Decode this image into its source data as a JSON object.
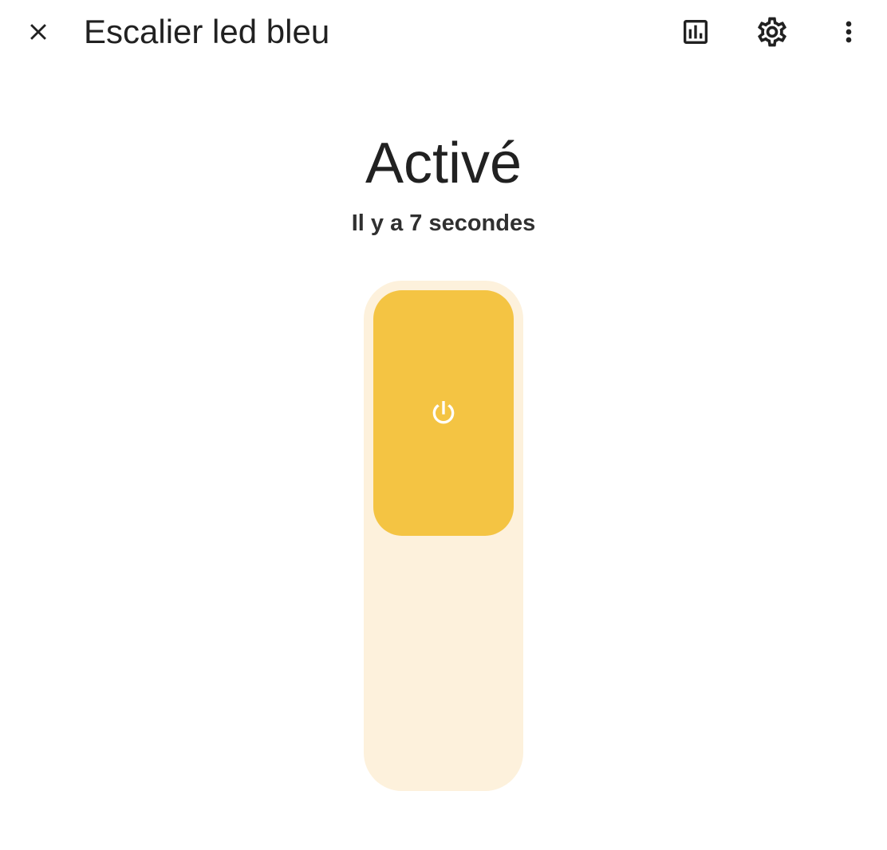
{
  "header": {
    "title": "Escalier led bleu",
    "close_icon": "close-icon",
    "history_icon": "chart-box-icon",
    "settings_icon": "gear-icon",
    "more_icon": "dots-vertical-icon"
  },
  "entity": {
    "state_label": "Activé",
    "last_changed": "Il y a 7 secondes",
    "is_on": true,
    "power_icon": "power-icon"
  },
  "colors": {
    "track": "#fdf1dc",
    "thumb": "#f4c443",
    "icon": "#212121",
    "thumb_icon": "#ffffff"
  }
}
